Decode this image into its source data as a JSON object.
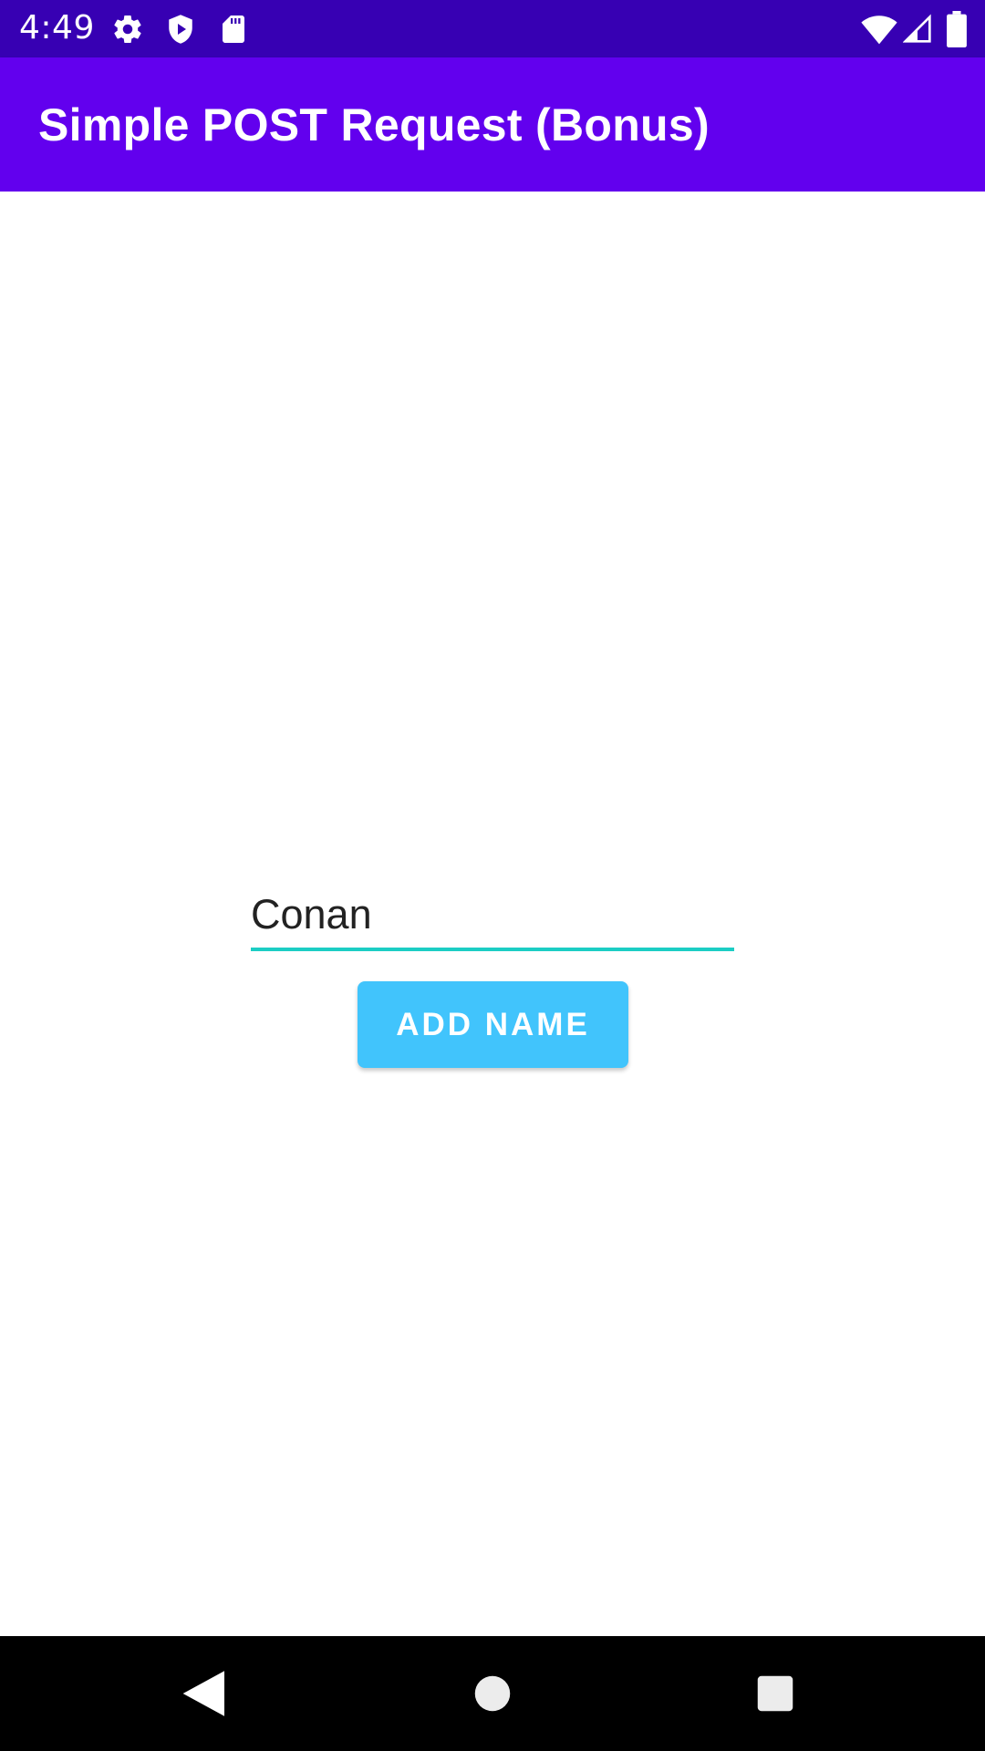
{
  "status_bar": {
    "time": "4:49",
    "icons": [
      "settings-icon",
      "shield-play-icon",
      "sd-card-icon",
      "wifi-icon",
      "signal-icon",
      "battery-icon"
    ]
  },
  "app_bar": {
    "title": "Simple POST Request (Bonus)"
  },
  "form": {
    "name_value": "Conan",
    "add_button_label": "ADD NAME"
  },
  "nav_bar": {
    "buttons": [
      "back-icon",
      "home-icon",
      "recents-icon"
    ]
  },
  "colors": {
    "status_bar": "#3700b3",
    "app_bar": "#6200ee",
    "accent_underline": "#1ccdc4",
    "button": "#41c4fc"
  }
}
